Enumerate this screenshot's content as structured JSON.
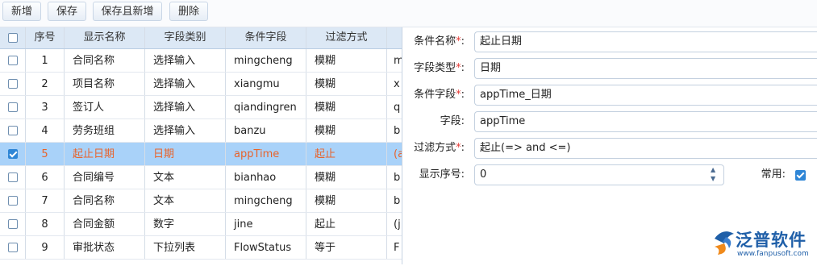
{
  "toolbar": {
    "new": "新增",
    "save": "保存",
    "save_new": "保存且新增",
    "delete": "删除"
  },
  "grid": {
    "headers": [
      "序号",
      "显示名称",
      "字段类别",
      "条件字段",
      "过滤方式"
    ],
    "rows": [
      {
        "no": "1",
        "name": "合同名称",
        "type": "选择输入",
        "field": "mingcheng",
        "filter": "模糊",
        "extra": "m",
        "checked": false
      },
      {
        "no": "2",
        "name": "项目名称",
        "type": "选择输入",
        "field": "xiangmu",
        "filter": "模糊",
        "extra": "x",
        "checked": false
      },
      {
        "no": "3",
        "name": "签订人",
        "type": "选择输入",
        "field": "qiandingren",
        "filter": "模糊",
        "extra": "q",
        "checked": false
      },
      {
        "no": "4",
        "name": "劳务班组",
        "type": "选择输入",
        "field": "banzu",
        "filter": "模糊",
        "extra": "b",
        "checked": false
      },
      {
        "no": "5",
        "name": "起止日期",
        "type": "日期",
        "field": "appTime",
        "filter": "起止",
        "extra": "(a",
        "checked": true
      },
      {
        "no": "6",
        "name": "合同编号",
        "type": "文本",
        "field": "bianhao",
        "filter": "模糊",
        "extra": "b",
        "checked": false
      },
      {
        "no": "7",
        "name": "合同名称",
        "type": "文本",
        "field": "mingcheng",
        "filter": "模糊",
        "extra": "b",
        "checked": false
      },
      {
        "no": "8",
        "name": "合同金额",
        "type": "数字",
        "field": "jine",
        "filter": "起止",
        "extra": "(j",
        "checked": false
      },
      {
        "no": "9",
        "name": "审批状态",
        "type": "下拉列表",
        "field": "FlowStatus",
        "filter": "等于",
        "extra": "F",
        "checked": false
      }
    ]
  },
  "form": {
    "cond_name_label": "条件名称",
    "cond_name_value": "起止日期",
    "field_type_label": "字段类型",
    "field_type_value": "日期",
    "cond_field_label": "条件字段",
    "cond_field_value": "appTime_日期",
    "field_label": "字段:",
    "field_value": "appTime",
    "filter_label": "过滤方式",
    "filter_value": "起止(=> and <=)",
    "order_label": "显示序号:",
    "order_value": "0",
    "common_label": "常用:",
    "required_mark": "*",
    "colon": ":"
  },
  "logo": {
    "name": "泛普软件",
    "url": "www.fanpusoft.com"
  },
  "colors": {
    "selected_row": "#a9d2f9",
    "selected_text": "#e8632b",
    "header_bg": "#dce8f5",
    "checkbox_accent": "#2f86d6",
    "logo_blue": "#1f5fa8",
    "logo_orange": "#f08a1c"
  }
}
